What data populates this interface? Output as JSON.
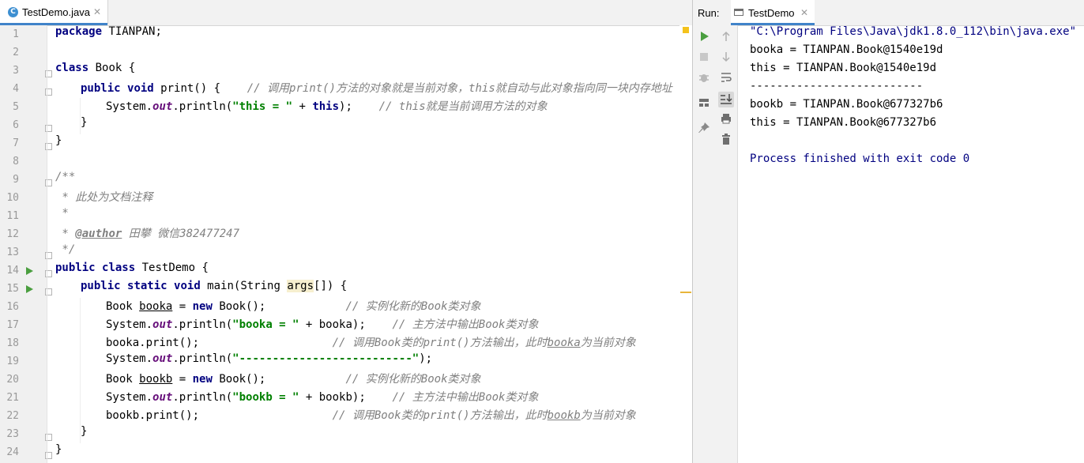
{
  "editor": {
    "tab": {
      "icon": "java-class-icon",
      "label": "TestDemo.java",
      "close": "✕"
    },
    "line_numbers": [
      "1",
      "2",
      "3",
      "4",
      "5",
      "6",
      "7",
      "8",
      "9",
      "10",
      "11",
      "12",
      "13",
      "14",
      "15",
      "16",
      "17",
      "18",
      "19",
      "20",
      "21",
      "22",
      "23",
      "24"
    ],
    "code": {
      "l1_kw": "package",
      "l1_rest": " TIANPAN;",
      "l3_kw": "class",
      "l3_rest": " Book {",
      "l4_kw1": "public",
      "l4_kw2": "void",
      "l4_rest": " print() {",
      "l4_comment": "// 调用print()方法的对象就是当前对象，this就自动与此对象指向同一块内存地址",
      "l5_a": "System.",
      "l5_out": "out",
      "l5_b": ".println(",
      "l5_str": "\"this = \"",
      "l5_c": " + ",
      "l5_this": "this",
      "l5_d": ");",
      "l5_comment": "// this就是当前调用方法的对象",
      "l6": "}",
      "l7": "}",
      "l9": "/**",
      "l10": " * 此处为文档注释",
      "l11": " *",
      "l12_a": " * ",
      "l12_tag": "@author",
      "l12_b": " 田攀 微信382477247",
      "l13": " */",
      "l14_kw1": "public",
      "l14_kw2": "class",
      "l14_rest": " TestDemo {",
      "l15_kw1": "public",
      "l15_kw2": "static",
      "l15_kw3": "void",
      "l15_a": " main(String ",
      "l15_args": "args",
      "l15_b": "[]) {",
      "l16_a": "Book ",
      "l16_var": "booka",
      "l16_b": " = ",
      "l16_new": "new",
      "l16_c": " Book();",
      "l16_comment": "// 实例化新的Book类对象",
      "l17_a": "System.",
      "l17_out": "out",
      "l17_b": ".println(",
      "l17_str": "\"booka = \"",
      "l17_c": " + booka);",
      "l17_comment": "// 主方法中输出Book类对象",
      "l18": "booka.print();",
      "l18_comment_a": "// 调用Book类的print()方法输出，此时",
      "l18_comment_u": "booka",
      "l18_comment_b": "为当前对象",
      "l19_a": "System.",
      "l19_out": "out",
      "l19_b": ".println(",
      "l19_str": "\"--------------------------\"",
      "l19_c": ");",
      "l20_a": "Book ",
      "l20_var": "bookb",
      "l20_b": " = ",
      "l20_new": "new",
      "l20_c": " Book();",
      "l20_comment": "// 实例化新的Book类对象",
      "l21_a": "System.",
      "l21_out": "out",
      "l21_b": ".println(",
      "l21_str": "\"bookb = \"",
      "l21_c": " + bookb);",
      "l21_comment": "// 主方法中输出Book类对象",
      "l22": "bookb.print();",
      "l22_comment_a": "// 调用Book类的print()方法输出，此时",
      "l22_comment_u": "bookb",
      "l22_comment_b": "为当前对象",
      "l23": "}",
      "l24": "}"
    }
  },
  "run_panel": {
    "label": "Run:",
    "tab": {
      "icon": "console-icon",
      "label": "TestDemo",
      "close": "✕"
    },
    "toolbar_left": [
      "run-icon",
      "stop-icon",
      "debug-bug-icon",
      "layout-icon",
      "pin-icon"
    ],
    "toolbar_right": [
      "up-arrow-icon",
      "down-arrow-icon",
      "soft-wrap-icon",
      "scroll-to-end-icon",
      "print-icon",
      "trash-icon"
    ],
    "output": [
      "\"C:\\Program Files\\Java\\jdk1.8.0_112\\bin\\java.exe\" ...",
      "booka = TIANPAN.Book@1540e19d",
      "this = TIANPAN.Book@1540e19d",
      "--------------------------",
      "bookb = TIANPAN.Book@677327b6",
      "this = TIANPAN.Book@677327b6",
      "",
      "Process finished with exit code 0"
    ]
  },
  "colors": {
    "keyword": "#000080",
    "string": "#008000",
    "comment": "#808080",
    "field": "#660e7a",
    "run_green": "#4a9e3f",
    "warning": "#f4c21c",
    "tab_underline": "#4083c9"
  }
}
